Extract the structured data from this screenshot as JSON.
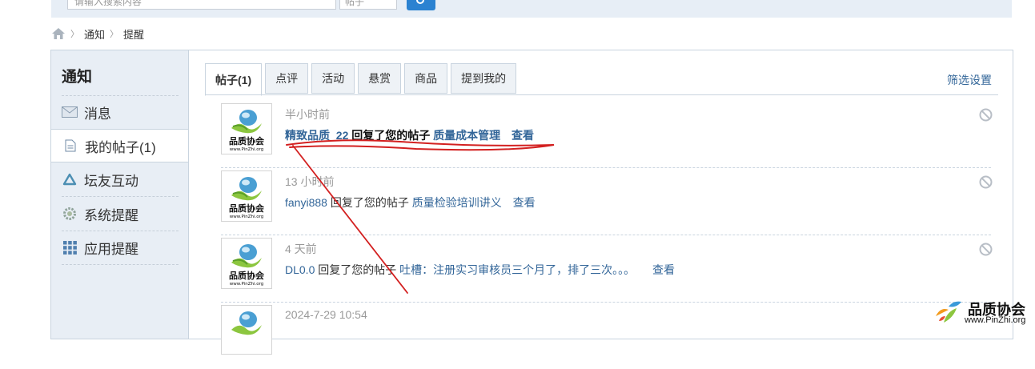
{
  "search": {
    "placeholder": "请输入搜索内容",
    "type_label": "帖子"
  },
  "breadcrumb": [
    "通知",
    "提醒"
  ],
  "sidebar": {
    "title": "通知",
    "items": [
      {
        "label": "消息",
        "icon": "envelope-icon"
      },
      {
        "label": "我的帖子(1)",
        "icon": "document-icon",
        "active": true
      },
      {
        "label": "坛友互动",
        "icon": "recycle-icon"
      },
      {
        "label": "系统提醒",
        "icon": "gear-icon"
      },
      {
        "label": "应用提醒",
        "icon": "grid-icon"
      }
    ]
  },
  "tabs": [
    {
      "label": "帖子(1)",
      "active": true
    },
    {
      "label": "点评"
    },
    {
      "label": "活动"
    },
    {
      "label": "悬赏"
    },
    {
      "label": "商品"
    },
    {
      "label": "提到我的"
    }
  ],
  "filter_label": "筛选设置",
  "notices": [
    {
      "time": "半小时前",
      "user": "精致品质_22",
      "verb": "回复了您的帖子",
      "thread": "质量成本管理",
      "view": "查看",
      "unread": true
    },
    {
      "time": "13 小时前",
      "user": "fanyi888",
      "verb": "回复了您的帖子",
      "thread": "质量检验培训讲义",
      "view": "查看"
    },
    {
      "time": "4 天前",
      "user": "DL0.0",
      "verb": "回复了您的帖子",
      "thread": "吐槽：注册实习审核员三个月了，排了三次。。。",
      "view": "查看"
    },
    {
      "time": "2024-7-29 10:54"
    }
  ],
  "avatar": {
    "title": "品质协会",
    "url": "www.PinZhi.org"
  },
  "watermark": {
    "title": "品质协会",
    "url": "www.PinZhi.org"
  },
  "colors": {
    "link": "#336699",
    "annotation": "#d32020",
    "sidebar_bg": "#e8eef5"
  }
}
